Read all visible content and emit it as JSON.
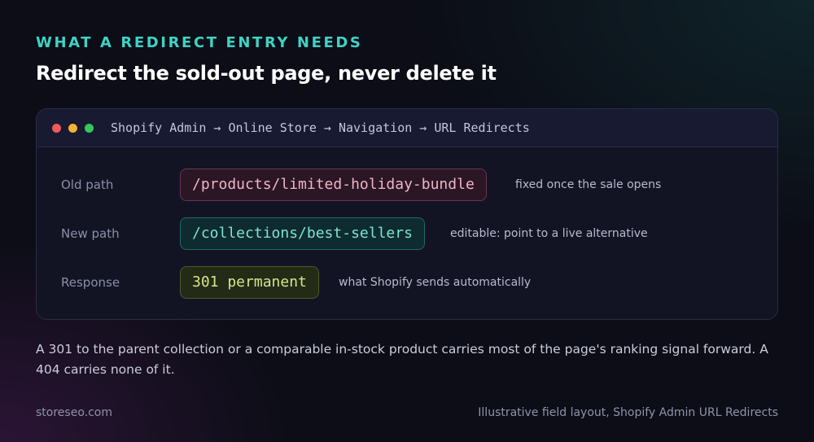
{
  "eyebrow": "WHAT A REDIRECT ENTRY NEEDS",
  "title": "Redirect the sold-out page, never delete it",
  "window": {
    "breadcrumb": "Shopify Admin → Online Store → Navigation → URL Redirects",
    "rows": [
      {
        "label": "Old path",
        "value": "/products/limited-holiday-bundle",
        "note": "fixed once the sale opens"
      },
      {
        "label": "New path",
        "value": "/collections/best-sellers",
        "note": "editable: point to a live alternative"
      },
      {
        "label": "Response",
        "value": "301 permanent",
        "note": "what Shopify sends automatically"
      }
    ]
  },
  "paragraph": "A 301 to the parent collection or a comparable in-stock product carries most of the page's ranking signal forward. A 404 carries none of it.",
  "footer": {
    "left": "storeseo.com",
    "right": "Illustrative field layout, Shopify Admin URL Redirects"
  }
}
